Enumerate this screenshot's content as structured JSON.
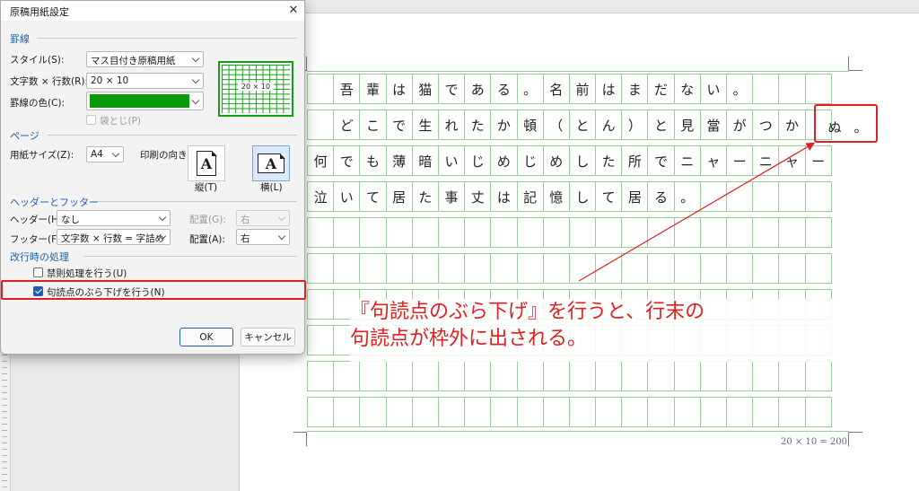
{
  "dialog": {
    "title": "原稿用紙設定",
    "close_symbol": "✕",
    "sections": {
      "lines": "罫線",
      "page": "ページ",
      "header_footer": "ヘッダーとフッター",
      "line_break": "改行時の処理"
    },
    "style_label": "スタイル(S):",
    "style_value": "マス目付き原稿用紙",
    "chars_label": "文字数 × 行数(R):",
    "chars_value": "20 × 10",
    "line_color_label": "罫線の色(C):",
    "line_color": "#0a9a0a",
    "fold_label": "袋とじ(P)",
    "preview_label": "20 × 10",
    "paper_size_label": "用紙サイズ(Z):",
    "paper_size_value": "A4",
    "orientation_label": "印刷の向き:",
    "portrait_label": "縦(T)",
    "landscape_label": "横(L)",
    "page_glyph": "A",
    "header_label": "ヘッダー(H):",
    "header_value": "なし",
    "header_align_label": "配置(G):",
    "header_align_value": "右",
    "footer_label": "フッター(F):",
    "footer_value": "文字数 × 行数 = 字詰め",
    "footer_align_label": "配置(A):",
    "footer_align_value": "右",
    "kinsoku_label": "禁則処理を行う(U)",
    "burasage_label": "句読点のぶら下げを行う(N)",
    "ok": "OK",
    "cancel": "キャンセル"
  },
  "document": {
    "rows": [
      [
        "",
        "吾",
        "輩",
        "は",
        "猫",
        "で",
        "あ",
        "る",
        "。",
        "名",
        "前",
        "は",
        "ま",
        "だ",
        "な",
        "い",
        "。",
        "",
        "",
        ""
      ],
      [
        "",
        "ど",
        "こ",
        "で",
        "生",
        "れ",
        "た",
        "か",
        "頓",
        "（",
        "と",
        "ん",
        "）",
        "と",
        "見",
        "當",
        "が",
        "つ",
        "か",
        ""
      ],
      [
        "何",
        "で",
        "も",
        "薄",
        "暗",
        "い",
        "じ",
        "め",
        "じ",
        "め",
        "し",
        "た",
        "所",
        "で",
        "ニ",
        "ャ",
        "ー",
        "ニ",
        "ャ",
        "ー"
      ],
      [
        "泣",
        "い",
        "て",
        "居",
        "た",
        "事",
        "丈",
        "は",
        "記",
        "憶",
        "し",
        "て",
        "居",
        "る",
        "。",
        "",
        "",
        "",
        "",
        ""
      ],
      [
        "",
        "",
        "",
        "",
        "",
        "",
        "",
        "",
        "",
        "",
        "",
        "",
        "",
        "",
        "",
        "",
        "",
        "",
        "",
        ""
      ],
      [
        "",
        "",
        "",
        "",
        "",
        "",
        "",
        "",
        "",
        "",
        "",
        "",
        "",
        "",
        "",
        "",
        "",
        "",
        "",
        ""
      ],
      [
        "",
        "",
        "",
        "",
        "",
        "",
        "",
        "",
        "",
        "",
        "",
        "",
        "",
        "",
        "",
        "",
        "",
        "",
        "",
        ""
      ],
      [
        "",
        "",
        "",
        "",
        "",
        "",
        "",
        "",
        "",
        "",
        "",
        "",
        "",
        "",
        "",
        "",
        "",
        "",
        "",
        ""
      ],
      [
        "",
        "",
        "",
        "",
        "",
        "",
        "",
        "",
        "",
        "",
        "",
        "",
        "",
        "",
        "",
        "",
        "",
        "",
        "",
        ""
      ],
      [
        "",
        "",
        "",
        "",
        "",
        "",
        "",
        "",
        "",
        "",
        "",
        "",
        "",
        "",
        "",
        "",
        "",
        "",
        "",
        ""
      ]
    ],
    "overflow_char_1": "ぬ",
    "overflow_char_2": "。",
    "footer_count": "20 × 10 = 200"
  },
  "annotation": {
    "line1": "『句読点のぶら下げ』を行うと、行末の",
    "line2": "句読点が枠外に出される。",
    "color": "#e02020"
  }
}
